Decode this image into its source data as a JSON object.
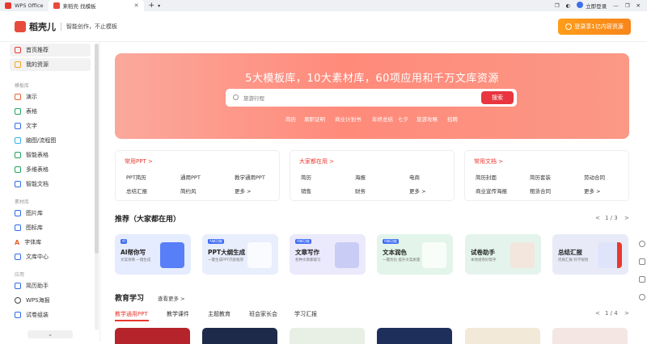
{
  "titlebar": {
    "tab1": "WPS Office",
    "tab2": "来稻壳 找模板",
    "plus": "+",
    "login": "立即登录"
  },
  "header": {
    "brand": "稻壳儿",
    "slogan": "智能创作，不止模板",
    "login_cta": "登录享1亿内容资源"
  },
  "sidebar": {
    "top": [
      "首页推荐",
      "我的资源"
    ],
    "group1_title": "模板库",
    "group1": [
      "演示",
      "表格",
      "文字",
      "脑图/流程图",
      "智能表格",
      "多维表格",
      "智能文档"
    ],
    "group2_title": "素材库",
    "group2": [
      "图片库",
      "图标库",
      "字体库",
      "文库中心"
    ],
    "group3_title": "应用",
    "group3": [
      "简历助手",
      "WPS海报",
      "试卷组装"
    ],
    "scroll_down": "⌄"
  },
  "banner": {
    "title": "5大模板库，10大素材库，60项应用和千万文库资源",
    "placeholder": "旅游行程",
    "search_btn": "搜索",
    "hot": [
      "简历",
      "离职证明",
      "商业计划书",
      "年终总结",
      "七夕",
      "旅游攻略",
      "招聘"
    ]
  },
  "cards": [
    {
      "title": "常用PPT  >",
      "links": [
        "PPT简历",
        "通用PPT",
        "教学通用PPT",
        "总结汇报",
        "简约风",
        "更多 >"
      ]
    },
    {
      "title": "大家都在用  >",
      "links": [
        "简历",
        "海报",
        "电商",
        "销售",
        "财务",
        "更多 >"
      ]
    },
    {
      "title": "常用文档  >",
      "links": [
        "简历封面",
        "简历套装",
        "劳动合同",
        "商业宣传海报",
        "租赁合同",
        "更多 >"
      ]
    }
  ],
  "recommend": {
    "title": "推荐（大家都在用）",
    "pager": "1 / 3",
    "prev": "<",
    "next": ">",
    "items": [
      {
        "tag": "AI",
        "title": "AI帮你写",
        "sub": "文案攻略 一键生成",
        "color": "#e6ecff"
      },
      {
        "tag": "AI新功能",
        "title": "PPT大纲生成",
        "sub": "一键生成PPT内容框架",
        "color": "#e8eefc"
      },
      {
        "tag": "AI新功能",
        "title": "文章写作",
        "sub": "各种文章都能写",
        "color": "#ebe9fc"
      },
      {
        "tag": "AI新功能",
        "title": "文本润色",
        "sub": "一键优化 提升文案质量",
        "color": "#e3f5ea"
      },
      {
        "tag": "",
        "title": "试卷助手",
        "sub": "本地组卷好帮手",
        "color": "#e4f4ec"
      },
      {
        "tag": "",
        "title": "总结汇报",
        "sub": "优质汇报 科学规划",
        "color": "#e8ebf7"
      }
    ]
  },
  "education": {
    "title": "教育学习",
    "more": "查看更多 >",
    "pager": "1 / 4",
    "prev": "<",
    "next": ">",
    "tabs": [
      "教学通用PPT",
      "教学课件",
      "主题教育",
      "班会家长会",
      "学习汇报"
    ]
  },
  "colors": {
    "accent": "#e8392f",
    "login_orange": "#f7851b",
    "banner": "#ff8a7a"
  }
}
